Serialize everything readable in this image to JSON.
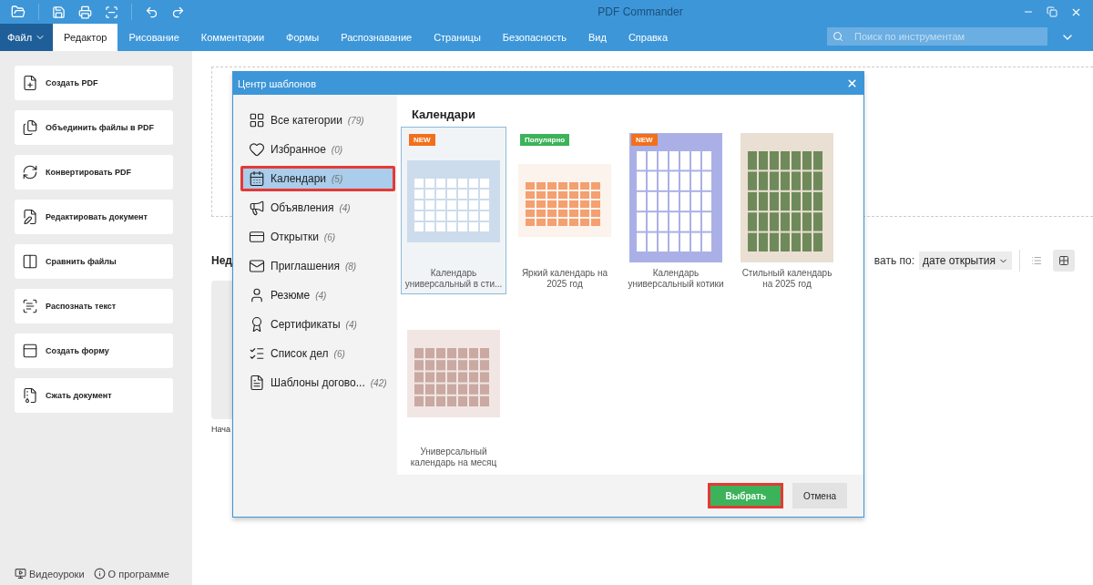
{
  "window": {
    "title": "PDF Commander"
  },
  "menu": {
    "file": "Файл",
    "tabs": [
      {
        "label": "Редактор",
        "selected": true
      },
      {
        "label": "Рисование",
        "selected": false
      },
      {
        "label": "Комментарии",
        "selected": false
      },
      {
        "label": "Формы",
        "selected": false
      },
      {
        "label": "Распознавание",
        "selected": false
      },
      {
        "label": "Страницы",
        "selected": false
      },
      {
        "label": "Безопасность",
        "selected": false
      },
      {
        "label": "Вид",
        "selected": false
      },
      {
        "label": "Справка",
        "selected": false
      }
    ]
  },
  "search": {
    "placeholder": "Поиск по инструментам"
  },
  "sidebar": {
    "actions": [
      {
        "label": "Создать PDF"
      },
      {
        "label": "Объединить файлы в PDF"
      },
      {
        "label": "Конвертировать PDF"
      },
      {
        "label": "Редактировать документ"
      },
      {
        "label": "Сравнить файлы"
      },
      {
        "label": "Распознать текст"
      },
      {
        "label": "Создать форму"
      },
      {
        "label": "Сжать документ"
      }
    ],
    "footer": [
      {
        "label": "Видеоуроки"
      },
      {
        "label": "О программе"
      }
    ]
  },
  "main": {
    "recent_heading": "Нед",
    "sort_label": "вать по:",
    "sort_value": "дате открытия",
    "views": [
      {
        "kind": "list",
        "selected": false
      },
      {
        "kind": "grid",
        "selected": true
      }
    ],
    "recent_files": [
      {
        "name": "Нача"
      }
    ]
  },
  "dialog": {
    "title": "Центр шаблонов",
    "heading": "Календари",
    "categories": [
      {
        "kind": "all",
        "label": "Все категории",
        "count": "(79)",
        "selected": false
      },
      {
        "kind": "favorites",
        "label": "Избранное",
        "count": "(0)",
        "selected": false
      },
      {
        "kind": "calendars",
        "label": "Календари",
        "count": "(5)",
        "selected": true
      },
      {
        "kind": "ads",
        "label": "Объявления",
        "count": "(4)",
        "selected": false
      },
      {
        "kind": "cards",
        "label": "Открытки",
        "count": "(6)",
        "selected": false
      },
      {
        "kind": "invitations",
        "label": "Приглашения",
        "count": "(8)",
        "selected": false
      },
      {
        "kind": "resume",
        "label": "Резюме",
        "count": "(4)",
        "selected": false
      },
      {
        "kind": "certificates",
        "label": "Сертификаты",
        "count": "(4)",
        "selected": false
      },
      {
        "kind": "todo",
        "label": "Список дел",
        "count": "(6)",
        "selected": false
      },
      {
        "kind": "contracts",
        "label": "Шаблоны догово...",
        "count": "(42)",
        "selected": false
      }
    ],
    "templates": [
      {
        "kind": "planner",
        "name": "Календарь универсальный в сти...",
        "badge": {
          "text": "NEW",
          "color": "#f26f1b"
        },
        "selected": true
      },
      {
        "kind": "bright",
        "name": "Яркий календарь на 2025 год",
        "badge": {
          "text": "Популярно",
          "color": "#3cb35a"
        },
        "selected": false
      },
      {
        "kind": "cats",
        "name": "Календарь универсальный котики",
        "badge": {
          "text": "NEW",
          "color": "#f26f1b"
        },
        "selected": false
      },
      {
        "kind": "stylish",
        "name": "Стильный календарь на 2025 год",
        "selected": false
      },
      {
        "kind": "monthly",
        "name": "Универсальный календарь на месяц",
        "selected": false
      }
    ],
    "buttons": [
      {
        "kind": "primary",
        "label": "Выбрать",
        "highlighted": true
      },
      {
        "kind": "secondary",
        "label": "Отмена",
        "highlighted": false
      }
    ]
  }
}
